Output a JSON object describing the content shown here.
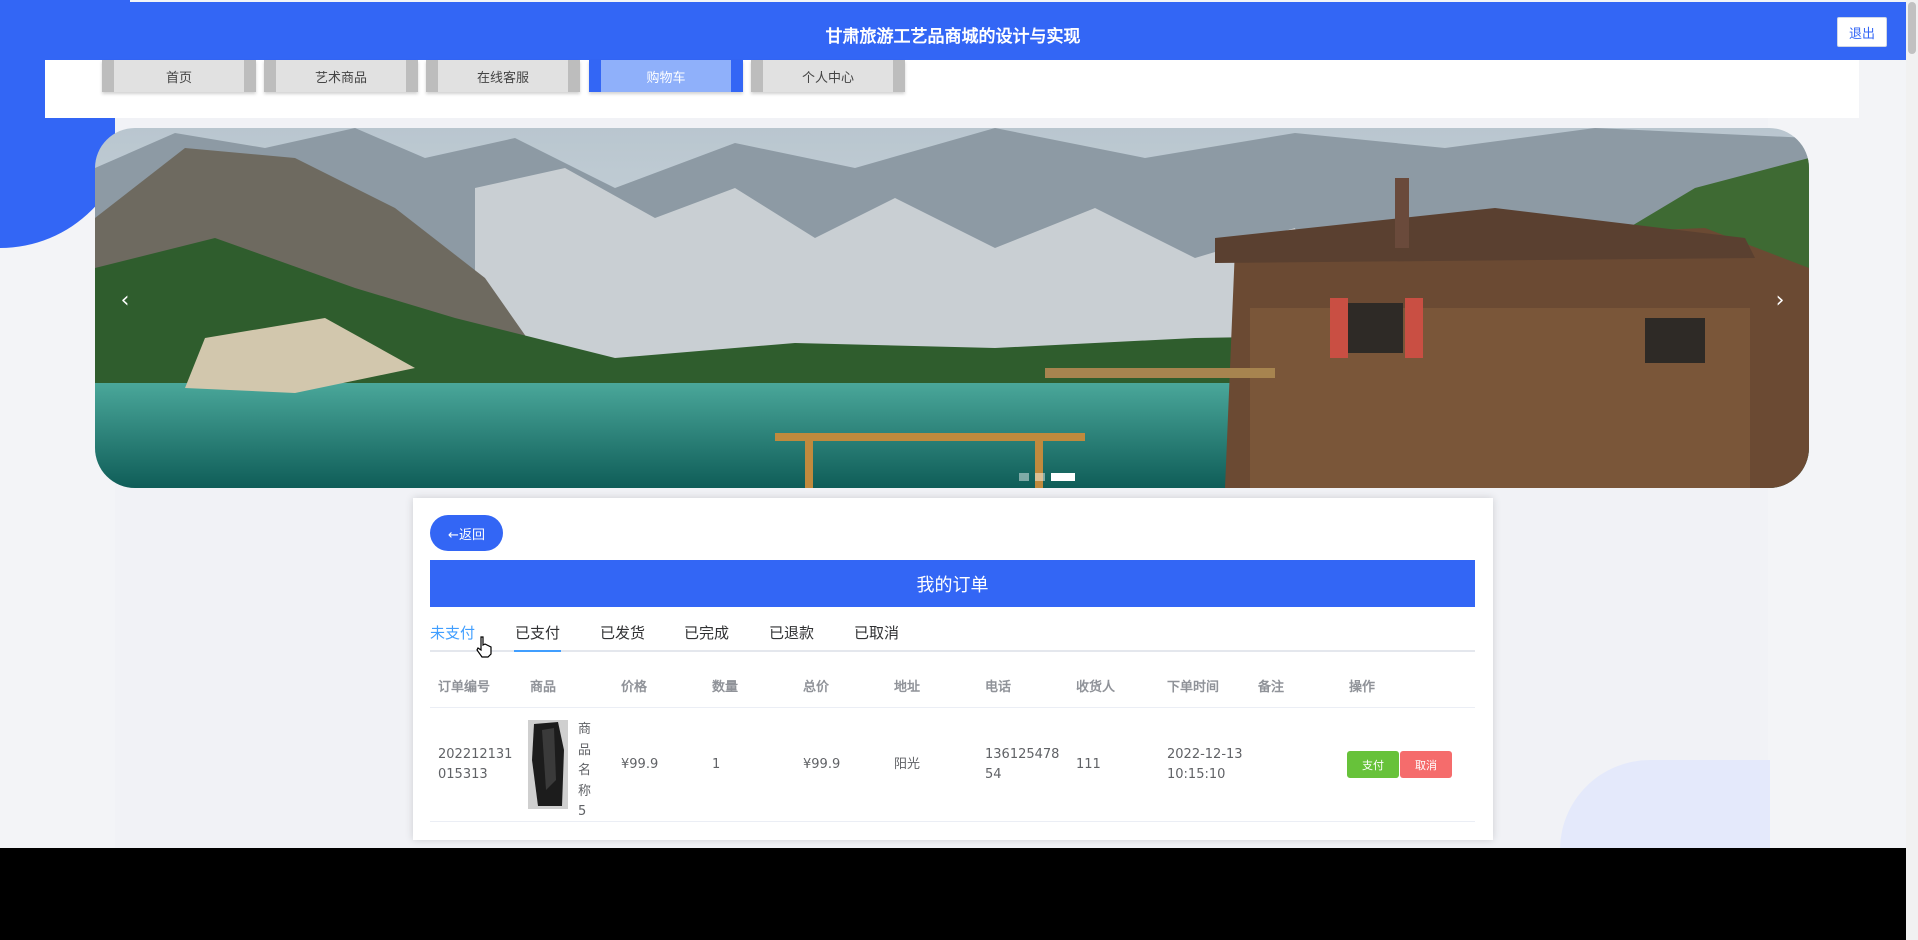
{
  "header": {
    "title": "甘肃旅游工艺品商城的设计与实现",
    "logout_label": "退出"
  },
  "nav": {
    "items": [
      {
        "label": "首页"
      },
      {
        "label": "艺术商品"
      },
      {
        "label": "在线客服"
      },
      {
        "label": "购物车",
        "active": true
      },
      {
        "label": "个人中心"
      }
    ]
  },
  "carousel": {
    "prev_icon": "‹",
    "next_icon": "›",
    "slide_count": 3,
    "active_slide": 3
  },
  "orders": {
    "back_label": "←返回",
    "title": "我的订单",
    "tabs": [
      {
        "label": "未支付",
        "state": "hover"
      },
      {
        "label": "已支付",
        "state": "active"
      },
      {
        "label": "已发货"
      },
      {
        "label": "已完成"
      },
      {
        "label": "已退款"
      },
      {
        "label": "已取消"
      }
    ],
    "columns": [
      "订单编号",
      "商品",
      "价格",
      "数量",
      "总价",
      "地址",
      "电话",
      "收货人",
      "下单时间",
      "备注",
      "操作"
    ],
    "rows": [
      {
        "order_no_line1": "202212131",
        "order_no_line2": "015313",
        "product_name": "商品名称5",
        "price": "¥99.9",
        "quantity": "1",
        "total": "¥99.9",
        "address": "阳光",
        "phone_line1": "136125478",
        "phone_line2": "54",
        "consignee": "111",
        "order_date": "2022-12-13",
        "order_time": "10:15:10",
        "remark": "",
        "pay_label": "支付",
        "cancel_label": "取消"
      }
    ]
  },
  "colors": {
    "primary": "#3366f5",
    "tab_active": "#409eff",
    "pay": "#67c23a",
    "cancel": "#f56c6c"
  }
}
